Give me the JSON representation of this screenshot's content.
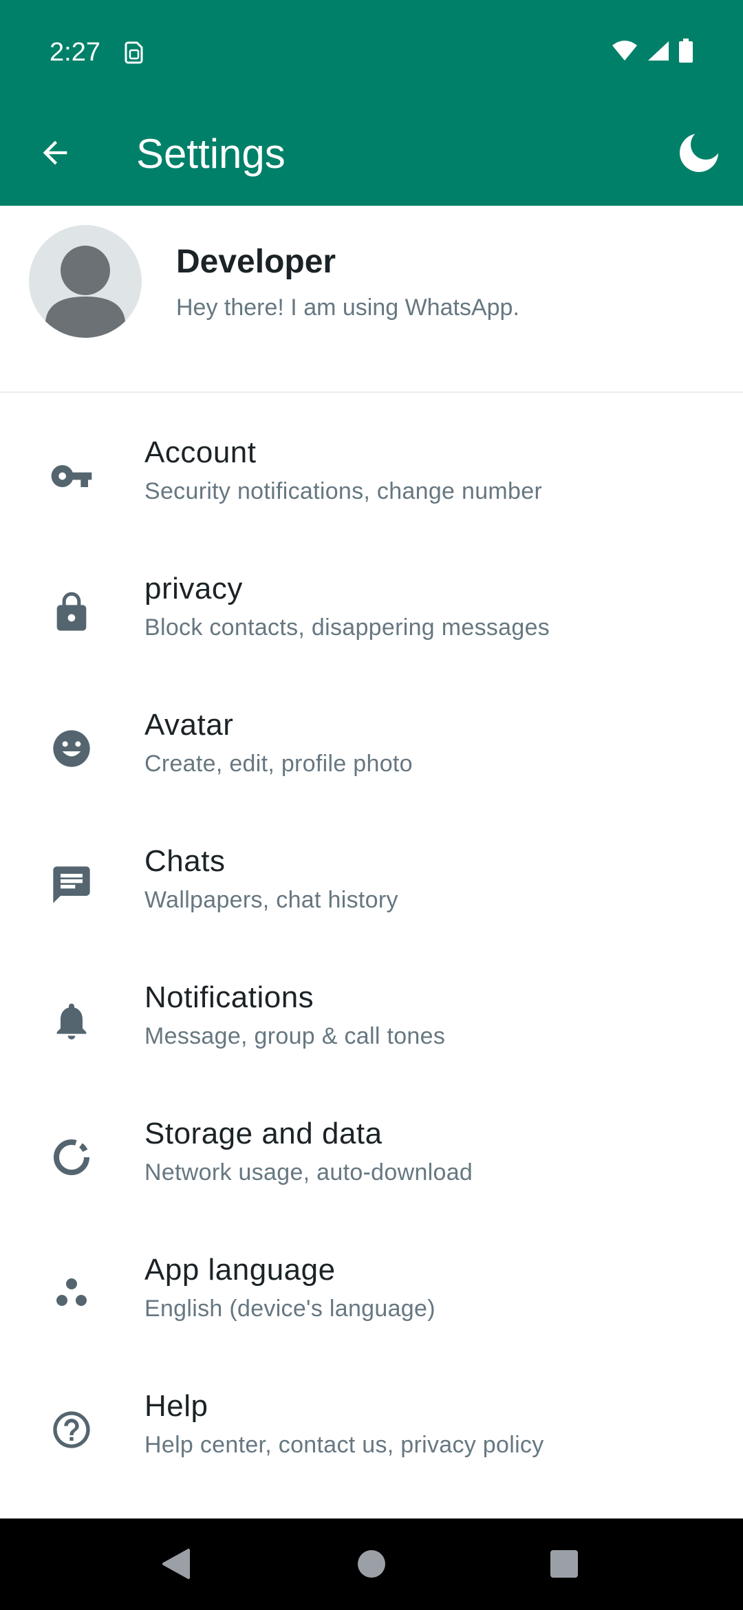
{
  "status_bar": {
    "time": "2:27",
    "icons": [
      "sim-card-icon",
      "wifi-icon",
      "cellular-signal-icon",
      "battery-icon"
    ]
  },
  "app_bar": {
    "title": "Settings",
    "back_icon": "arrow-back-icon",
    "theme_icon": "moon-icon"
  },
  "profile": {
    "name": "Developer",
    "about": "Hey there! I am using WhatsApp."
  },
  "settings_items": [
    {
      "title": "Account",
      "subtitle": "Security notifications, change number",
      "icon": "key-icon"
    },
    {
      "title": "privacy",
      "subtitle": "Block contacts, disappering messages",
      "icon": "lock-icon"
    },
    {
      "title": "Avatar",
      "subtitle": "Create, edit, profile photo",
      "icon": "smiley-icon"
    },
    {
      "title": "Chats",
      "subtitle": "Wallpapers, chat history",
      "icon": "chat-icon"
    },
    {
      "title": "Notifications",
      "subtitle": "Message, group & call tones",
      "icon": "bell-icon"
    },
    {
      "title": "Storage and data",
      "subtitle": "Network usage, auto-download",
      "icon": "storage-circle-icon"
    },
    {
      "title": "App language",
      "subtitle": "English (device's language)",
      "icon": "language-dots-icon"
    },
    {
      "title": "Help",
      "subtitle": "Help center, contact us, privacy policy",
      "icon": "help-icon"
    }
  ],
  "nav_bar": {
    "icons": [
      "back-triangle-icon",
      "home-circle-icon",
      "recents-square-icon"
    ]
  },
  "colors": {
    "brand_green": "#008069",
    "icon_gray": "#54656f",
    "subtitle_gray": "#667781",
    "title_dark": "#1b2327"
  }
}
